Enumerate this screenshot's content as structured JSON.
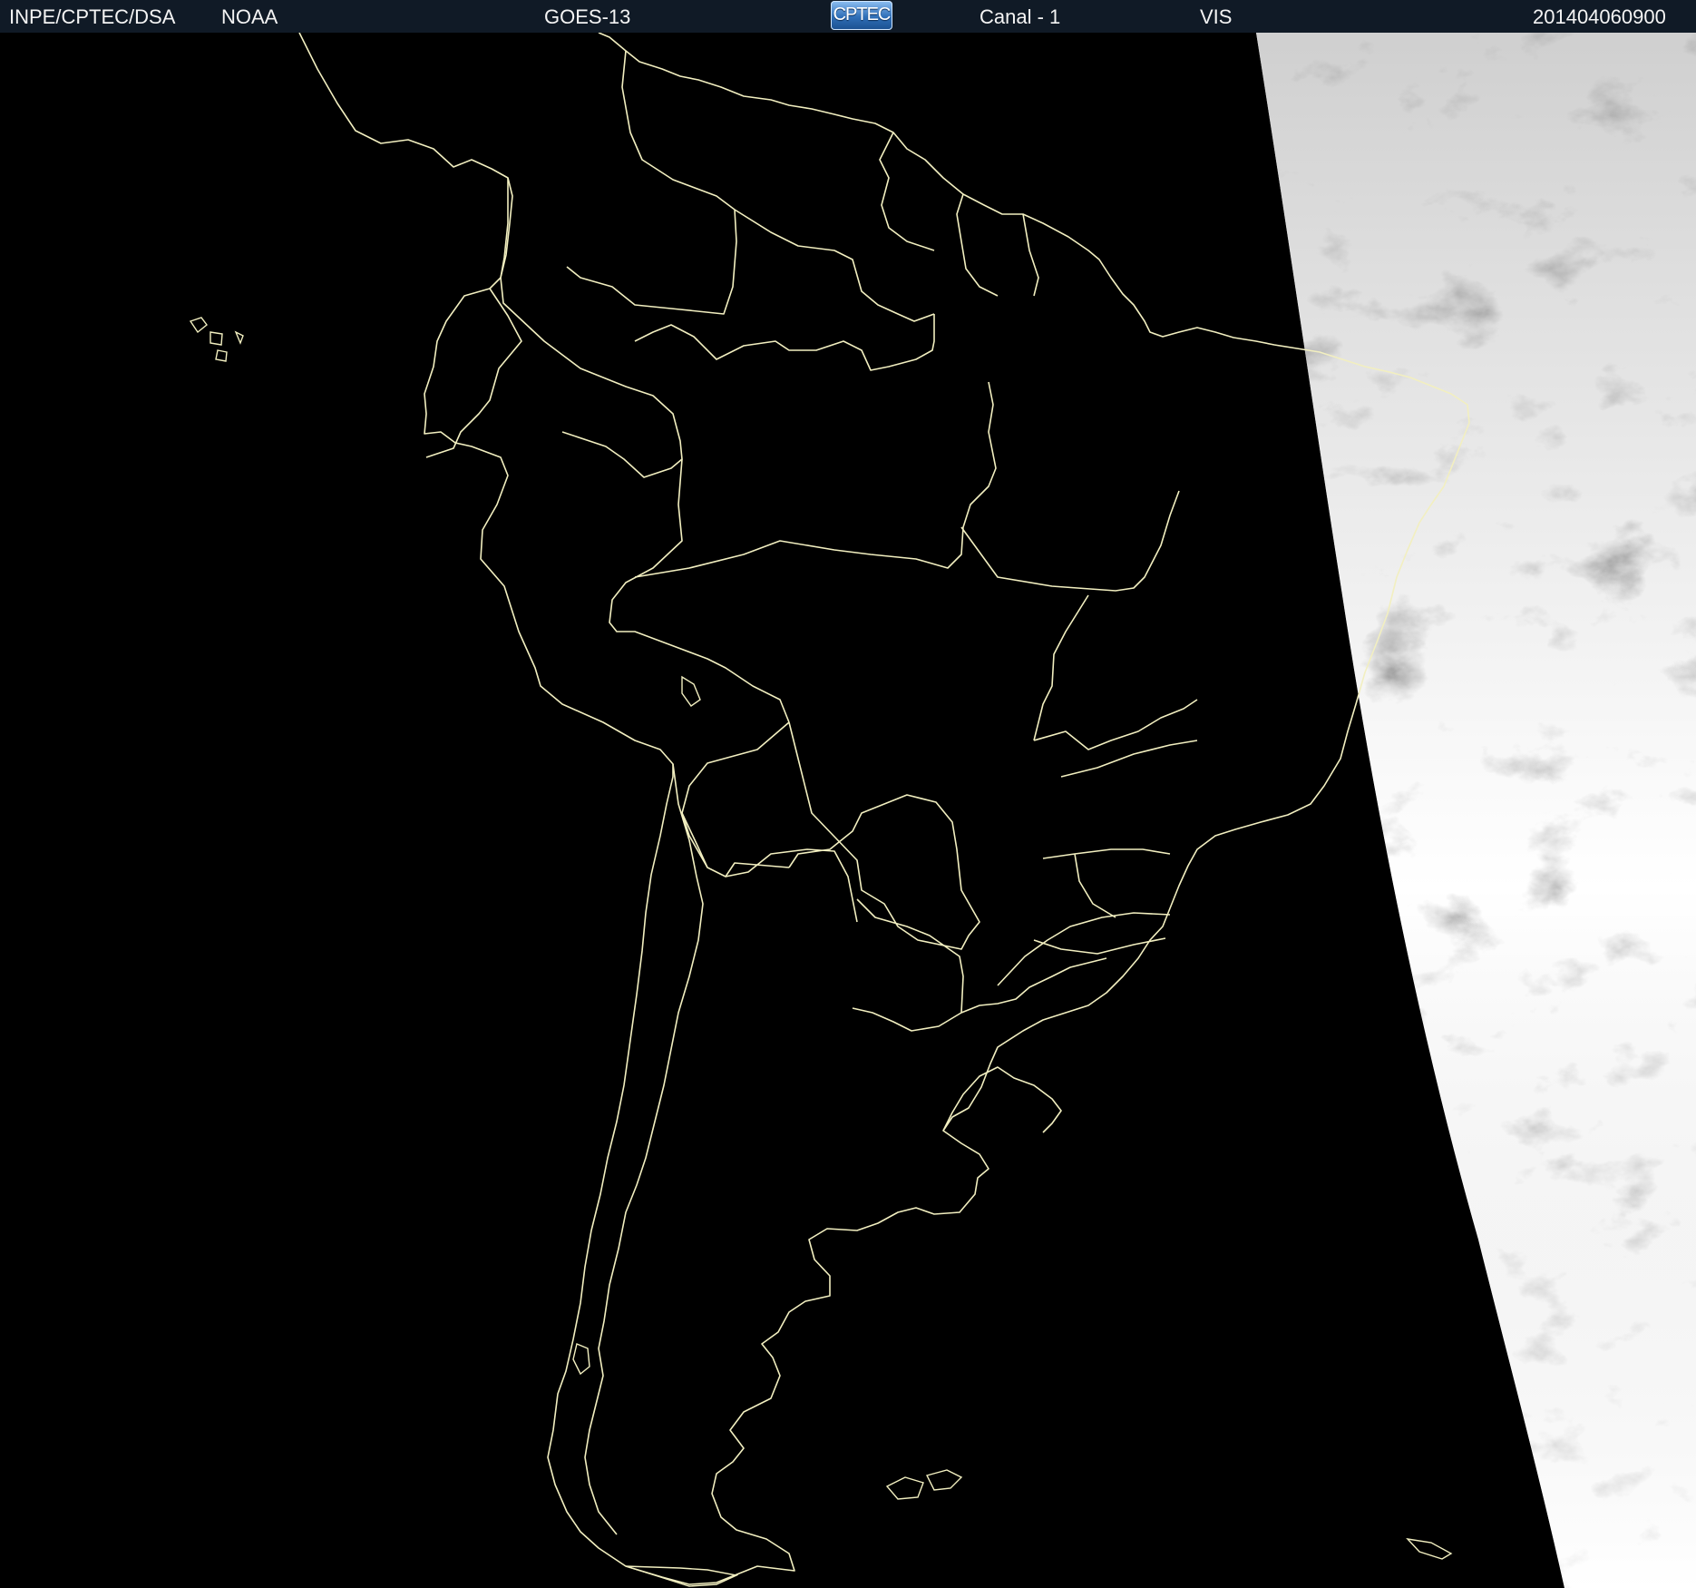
{
  "header": {
    "agency": "INPE/CPTEC/DSA",
    "source": "NOAA",
    "satellite": "GOES-13",
    "logo_text": "CPTEC",
    "channel": "Canal - 1",
    "band": "VIS",
    "timestamp": "201404060900"
  },
  "colors": {
    "header_background": "#101a26",
    "header_text": "#f4f4f4",
    "land_background": "#000000",
    "borders": "#f2efc0",
    "cloud_light": "#dcdcdc",
    "cloud_dark": "#5a5a5a"
  },
  "map": {
    "region": "South America",
    "product": "visible satellite imagery with political boundaries"
  }
}
